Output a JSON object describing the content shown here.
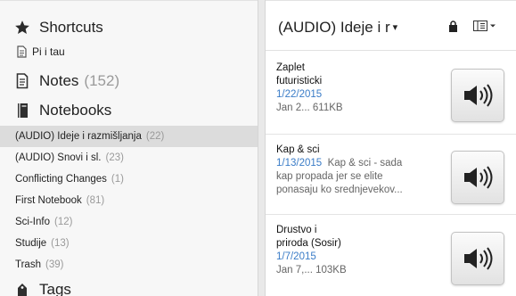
{
  "sidebar": {
    "shortcuts": {
      "label": "Shortcuts",
      "icon": "star-icon"
    },
    "shortcut_item": {
      "label": "Pi i tau",
      "icon": "note-icon"
    },
    "notes": {
      "label": "Notes",
      "count": "(152)",
      "icon": "notes-icon"
    },
    "notebooks": {
      "label": "Notebooks",
      "icon": "notebooks-icon"
    },
    "notebook_items": [
      {
        "label": "(AUDIO) Ideje i razmišljanja",
        "count": "(22)",
        "selected": true
      },
      {
        "label": "(AUDIO) Snovi i sl.",
        "count": "(23)"
      },
      {
        "label": "Conflicting Changes",
        "count": "(1)"
      },
      {
        "label": "First Notebook",
        "count": "(81)"
      },
      {
        "label": "Sci-Info",
        "count": "(12)"
      },
      {
        "label": "Studije",
        "count": "(13)"
      },
      {
        "label": "Trash",
        "count": "(39)"
      }
    ],
    "tags": {
      "label": "Tags",
      "icon": "tags-icon"
    }
  },
  "note_list": {
    "title": "(AUDIO) Ideje i r",
    "caret": "▾",
    "icons": [
      "share-icon",
      "view-options-icon"
    ],
    "notes": [
      {
        "title_line1": "Zaplet",
        "title_line2": "futuristicki",
        "date": "1/22/2015",
        "meta": "Jan 2...  611KB"
      },
      {
        "title_line1": "Kap & sci",
        "date": "1/13/2015",
        "snippet_inline": "Kap & sci - sada",
        "snippet_line2": "kap propada jer se elite",
        "snippet_line3": "ponasaju ko srednjevekov..."
      },
      {
        "title_line1": "Drustvo i",
        "title_line2": "priroda (Sosir)",
        "date": "1/7/2015",
        "meta": "Jan 7,...  103KB"
      }
    ]
  }
}
